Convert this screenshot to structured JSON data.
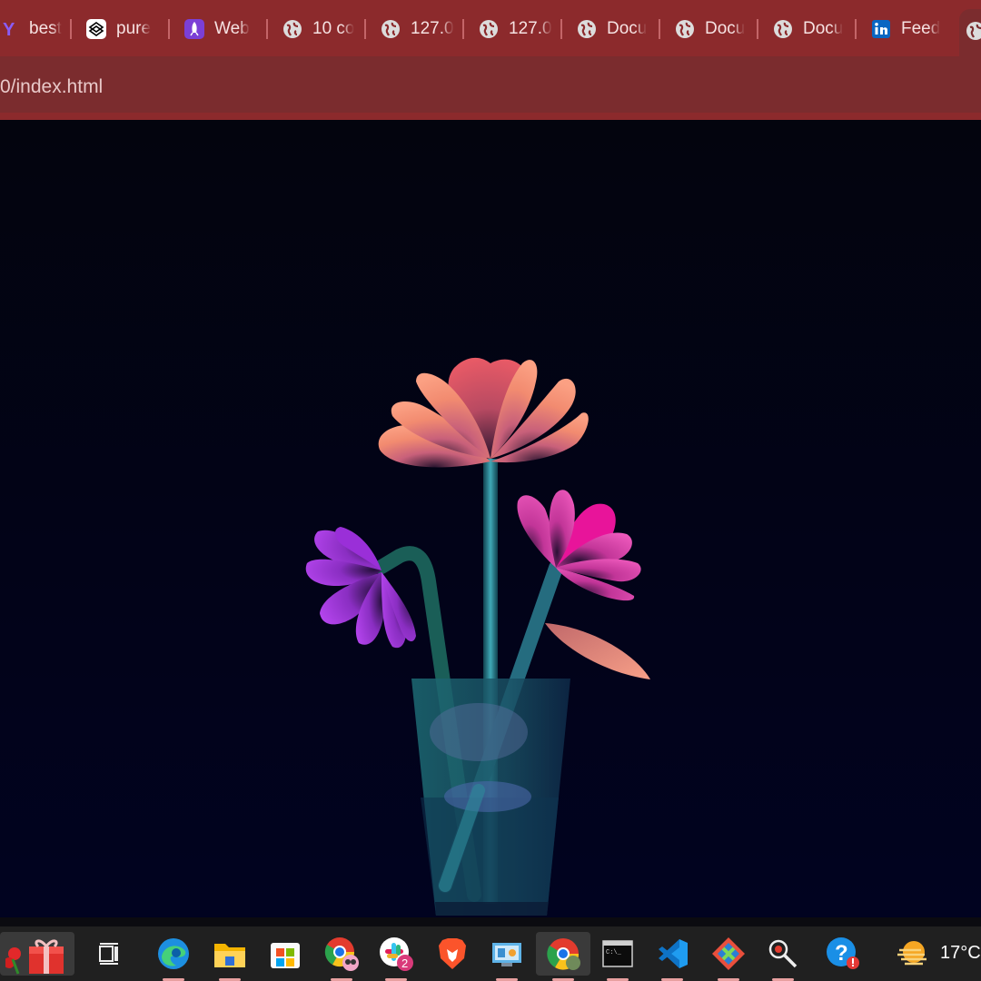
{
  "browser": {
    "tabs": [
      {
        "label": "best",
        "icon": "yahoo-icon"
      },
      {
        "label": "pure",
        "icon": "codepen-icon"
      },
      {
        "label": "Web",
        "icon": "rocket-icon"
      },
      {
        "label": "10 co",
        "icon": "globe-icon"
      },
      {
        "label": "127.0",
        "icon": "globe-icon"
      },
      {
        "label": "127.0",
        "icon": "globe-icon"
      },
      {
        "label": "Docu",
        "icon": "globe-icon"
      },
      {
        "label": "Docu",
        "icon": "globe-icon"
      },
      {
        "label": "Docu",
        "icon": "globe-icon"
      },
      {
        "label": "Feed",
        "icon": "linkedin-icon"
      }
    ],
    "address": "0/index.html",
    "theme_color": "#8c2a2c"
  },
  "taskbar": {
    "apps": [
      "widgets-flowers-gift",
      "task-view",
      "edge",
      "file-explorer",
      "microsoft-store",
      "chrome-profile",
      "slack",
      "brave",
      "control-panel",
      "chrome-active",
      "terminal",
      "vscode",
      "git-tool",
      "magnifier",
      "help"
    ],
    "slack_badge": "2",
    "weather": {
      "temp": "17°C",
      "icon": "hazy-sun-icon"
    }
  },
  "scene": {
    "colors": {
      "peach": "#f28b70",
      "pink": "#e83aa5",
      "purple": "#a43be0",
      "stem": "#1e6f78",
      "vase": "#1c5a6a"
    }
  }
}
